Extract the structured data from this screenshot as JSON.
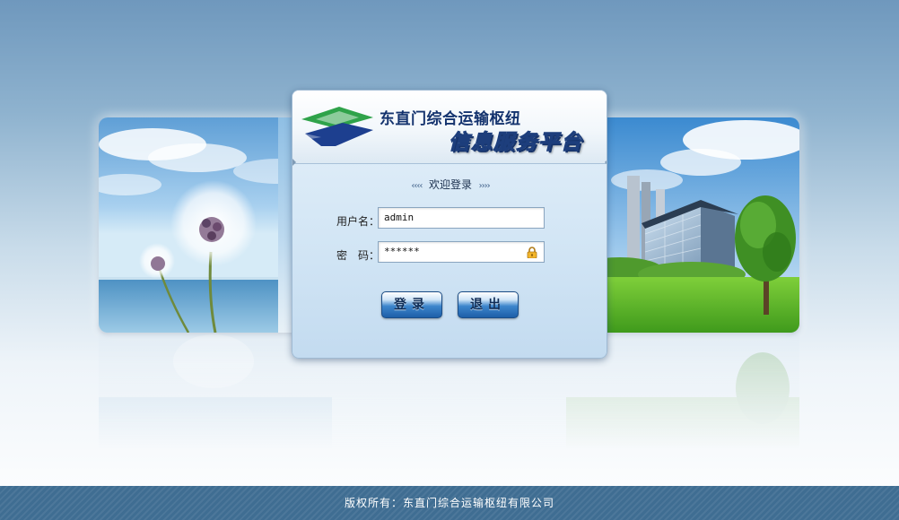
{
  "header": {
    "org_name": "东直门综合运输枢纽",
    "platform_name": "信息服务平台",
    "logo_icon": "organization-logo-icon"
  },
  "login": {
    "welcome_text": "欢迎登录",
    "welcome_left_arrows": "‹‹‹‹",
    "welcome_right_arrows": "››››",
    "username_label": "用户名：",
    "username_value": "admin",
    "password_label": "密　码：",
    "password_value": "******",
    "password_icon": "lock-icon",
    "login_button": "登录",
    "exit_button": "退出"
  },
  "footer": {
    "copyright": "版权所有：东直门综合运输枢纽有限公司"
  },
  "colors": {
    "title_blue": "#14336e",
    "button_blue": "#1d5ea8",
    "footer_bg": "#3f6d92"
  }
}
